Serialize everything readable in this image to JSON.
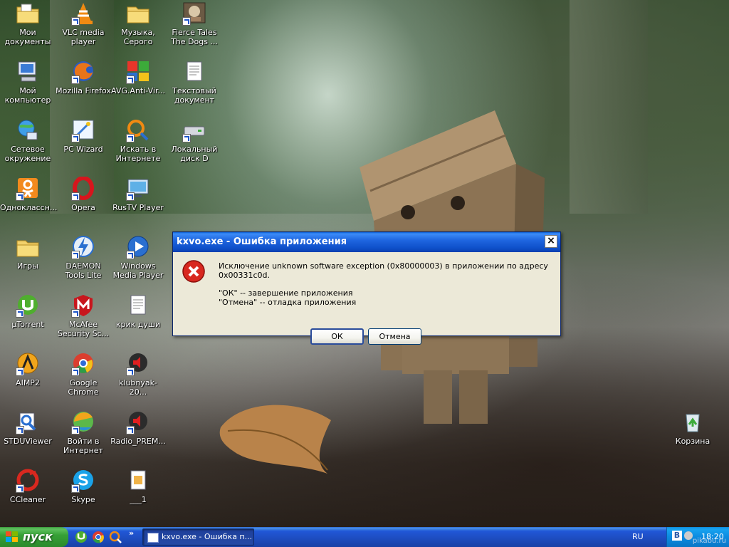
{
  "desktop": {
    "icons": [
      {
        "label": "Мои документы",
        "icon": "folder-documents-icon"
      },
      {
        "label": "VLC media player",
        "icon": "vlc-icon"
      },
      {
        "label": "Музыка, Серого",
        "icon": "folder-icon"
      },
      {
        "label": "Fierce Tales The Dogs ...",
        "icon": "game-icon"
      },
      {
        "label": "Мой компьютер",
        "icon": "computer-icon"
      },
      {
        "label": "Mozilla Firefox",
        "icon": "firefox-icon"
      },
      {
        "label": "AVG.Anti-Vir...",
        "icon": "avg-icon"
      },
      {
        "label": "Текстовый документ",
        "icon": "text-document-icon"
      },
      {
        "label": "Сетевое окружение",
        "icon": "network-icon"
      },
      {
        "label": "PC Wizard",
        "icon": "pcwizard-icon"
      },
      {
        "label": "Искать в Интернете",
        "icon": "search-web-icon"
      },
      {
        "label": "Локальный диск D",
        "icon": "drive-icon"
      },
      {
        "label": "Одноклассн...",
        "icon": "odnoklassniki-icon"
      },
      {
        "label": "Opera",
        "icon": "opera-icon"
      },
      {
        "label": "RusTV Player",
        "icon": "tv-icon"
      },
      {
        "label": "Игры",
        "icon": "folder-icon"
      },
      {
        "label": "DAEMON Tools Lite",
        "icon": "daemon-tools-icon"
      },
      {
        "label": "Windows Media Player",
        "icon": "media-player-icon"
      },
      {
        "label": "µTorrent",
        "icon": "utorrent-icon"
      },
      {
        "label": "McAfee Security Sc...",
        "icon": "mcafee-icon"
      },
      {
        "label": "крик души",
        "icon": "text-document-icon"
      },
      {
        "label": "AIMP2",
        "icon": "aimp-icon"
      },
      {
        "label": "Google Chrome",
        "icon": "chrome-icon"
      },
      {
        "label": "klubnyak-20...",
        "icon": "audio-file-icon"
      },
      {
        "label": "STDUViewer",
        "icon": "stduviewer-icon"
      },
      {
        "label": "Войти в Интернет",
        "icon": "internet-connect-icon"
      },
      {
        "label": "Radio_PREM...",
        "icon": "audio-file-icon"
      },
      {
        "label": "CCleaner",
        "icon": "ccleaner-icon"
      },
      {
        "label": "Skype",
        "icon": "skype-icon"
      },
      {
        "label": "___1",
        "icon": "file-icon"
      },
      {
        "label": "Корзина",
        "icon": "recycle-bin-icon"
      }
    ]
  },
  "dialog": {
    "title": "kxvo.exe - Ошибка приложения",
    "close_label": "×",
    "message_line1": "Исключение unknown software exception (0x80000003) в приложении по адресу 0x00331c0d.",
    "message_line2": "\"ОК\" -- завершение приложения",
    "message_line3": "\"Отмена\" -- отладка приложения",
    "ok_label": "ОК",
    "cancel_label": "Отмена"
  },
  "taskbar": {
    "start_label": "пуск",
    "quicklaunch_chevron": "»",
    "task_label": "kxvo.exe - Ошибка п...",
    "language": "RU",
    "tray_badge": "В",
    "clock": "18:20"
  },
  "watermark": "pikabu.ru",
  "colors": {
    "taskbar_blue": "#245edb",
    "start_green": "#3c9a3c",
    "dialog_title_blue": "#0a5fd8",
    "dialog_face": "#ece9d8"
  }
}
